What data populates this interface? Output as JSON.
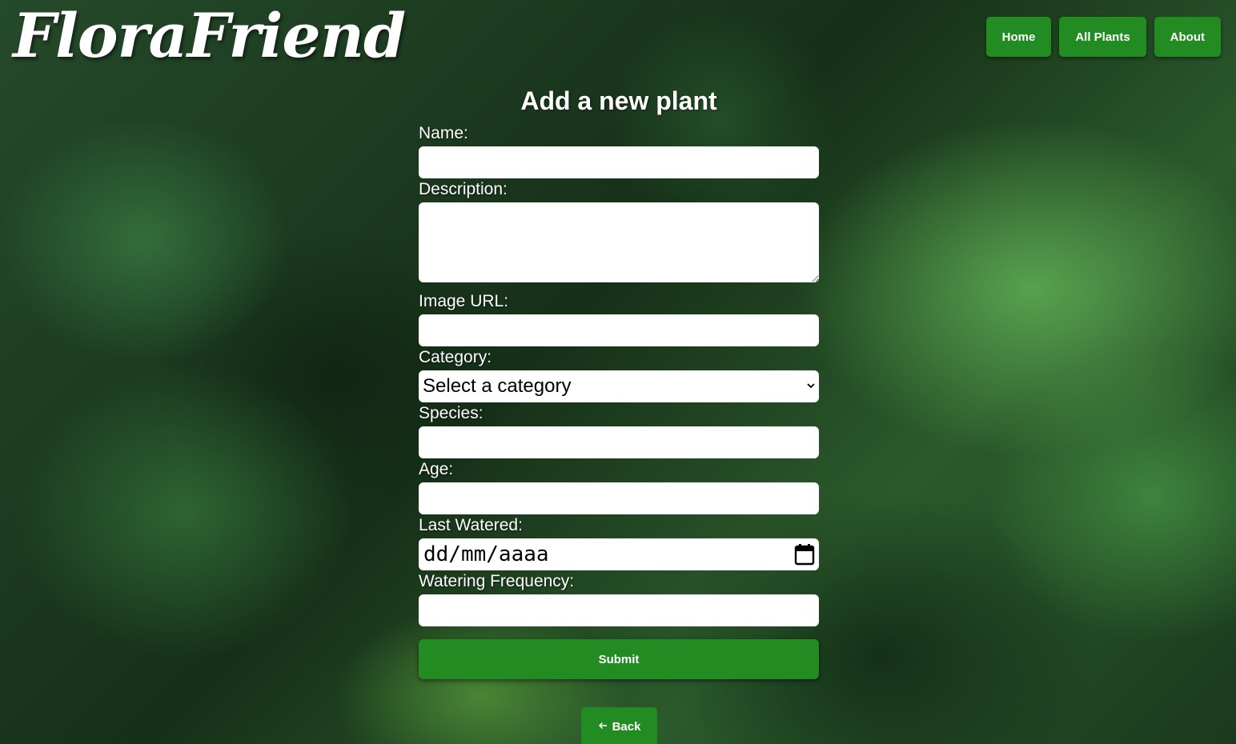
{
  "header": {
    "logo": "FloraFriend",
    "nav": [
      {
        "label": "Home"
      },
      {
        "label": "All Plants"
      },
      {
        "label": "About"
      }
    ]
  },
  "form": {
    "title": "Add a new plant",
    "fields": {
      "name": {
        "label": "Name:",
        "value": ""
      },
      "description": {
        "label": "Description:",
        "value": ""
      },
      "image_url": {
        "label": "Image URL:",
        "value": ""
      },
      "category": {
        "label": "Category:",
        "selected": "Select a category"
      },
      "species": {
        "label": "Species:",
        "value": ""
      },
      "age": {
        "label": "Age:",
        "value": ""
      },
      "last_watered": {
        "label": "Last Watered:",
        "placeholder": "dd/mm/aaaa"
      },
      "watering_frequency": {
        "label": "Watering Frequency:",
        "value": ""
      }
    },
    "submit_label": "Submit"
  },
  "back": {
    "label": "Back",
    "icon": "arrow-left-icon"
  },
  "colors": {
    "accent": "#228b22",
    "text": "#ffffff",
    "input_bg": "#ffffff"
  }
}
